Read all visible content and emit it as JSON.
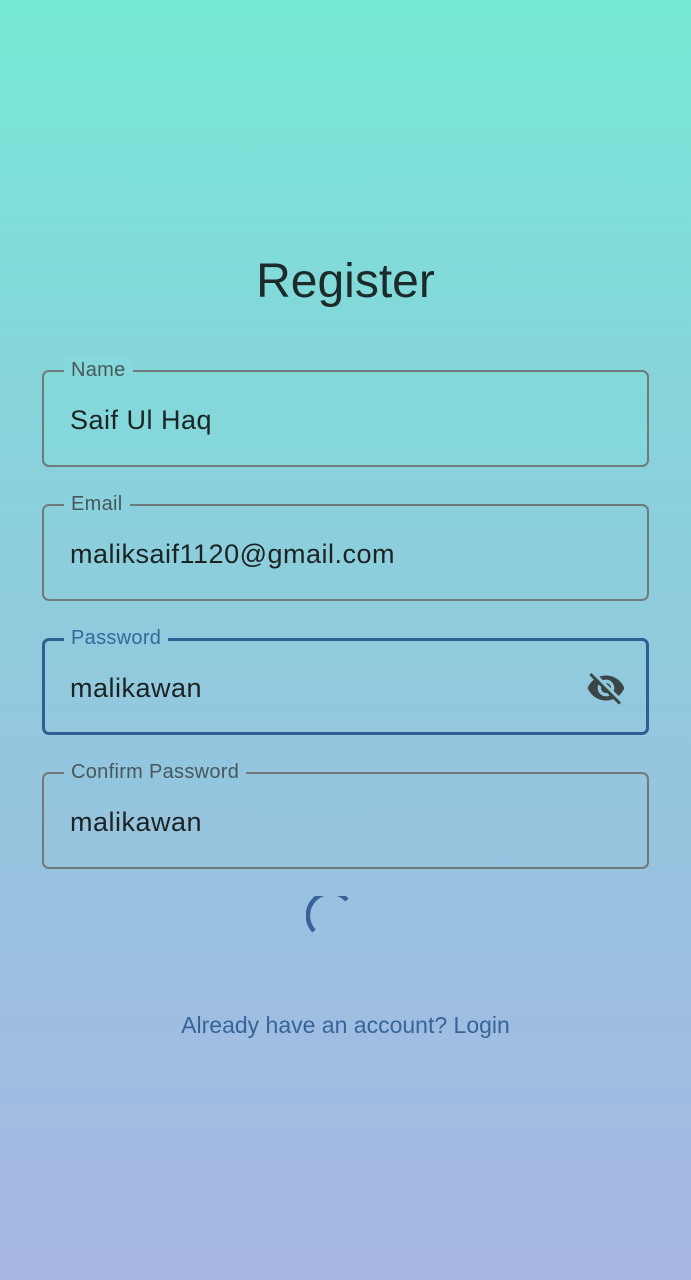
{
  "page": {
    "title": "Register"
  },
  "form": {
    "name": {
      "label": "Name",
      "value": "Saif Ul Haq"
    },
    "email": {
      "label": "Email",
      "value": "maliksaif1120@gmail.com"
    },
    "password": {
      "label": "Password",
      "value": "malikawan",
      "toggle_icon": "visibility-off-icon"
    },
    "confirm_password": {
      "label": "Confirm Password",
      "value": "malikawan"
    }
  },
  "loading": {
    "icon": "progress-spinner"
  },
  "footer": {
    "login_link": "Already have an account? Login"
  },
  "colors": {
    "background_top": "#76ead6",
    "background_bottom": "#a8b7e4",
    "accent": "#36689a",
    "text": "#1b2323",
    "border": "#707a7c"
  }
}
